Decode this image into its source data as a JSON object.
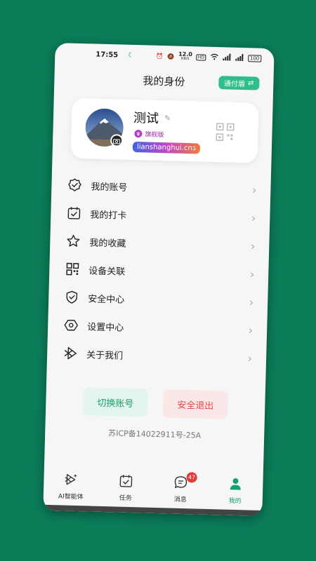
{
  "status_bar": {
    "time": "17:55",
    "speed_top": "12.0",
    "speed_unit": "KB/S",
    "hd": "HD",
    "battery": "100"
  },
  "header": {
    "title": "我的身份",
    "tongfu_label": "通付盾",
    "tongfu_icon": "swap-icon"
  },
  "profile": {
    "name": "测试",
    "tier": "旗舰版",
    "domain": "lianshanghui.cns"
  },
  "menu": [
    {
      "label": "我的账号",
      "icon": "account-badge-icon"
    },
    {
      "label": "我的打卡",
      "icon": "calendar-check-icon"
    },
    {
      "label": "我的收藏",
      "icon": "star-icon"
    },
    {
      "label": "设备关联",
      "icon": "device-grid-icon"
    },
    {
      "label": "安全中心",
      "icon": "shield-check-icon"
    },
    {
      "label": "设置中心",
      "icon": "hexagon-settings-icon"
    },
    {
      "label": "关于我们",
      "icon": "about-cube-icon"
    }
  ],
  "actions": {
    "switch_label": "切换账号",
    "logout_label": "安全退出"
  },
  "footer": {
    "icp": "苏ICP备14022911号-25A"
  },
  "tabbar": {
    "tabs": [
      {
        "label": "AI智能体",
        "icon": "ai-agent-icon"
      },
      {
        "label": "任务",
        "icon": "task-icon"
      },
      {
        "label": "消息",
        "icon": "message-icon",
        "badge": "47"
      },
      {
        "label": "我的",
        "icon": "user-icon",
        "active": true
      }
    ]
  },
  "colors": {
    "background": "#0b7b58",
    "accent": "#17a06e",
    "danger": "#e24a4a",
    "badge": "#e53935"
  }
}
